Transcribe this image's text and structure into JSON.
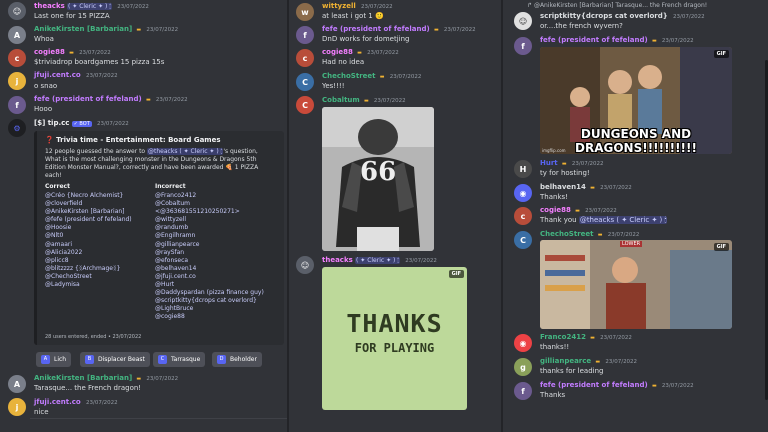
{
  "column1": {
    "messages": [
      {
        "name": "theacks",
        "decor": "( ✦ Cleric ✦ ) 🕯",
        "time": "23/07/2022",
        "text": "Last one for 15 PIZZA",
        "color": "#f47fff"
      },
      {
        "name": "AnikeKirsten [Barbarian]",
        "time": "23/07/2022",
        "text": "Whoa",
        "color": "#43b581"
      },
      {
        "name": "cogie88",
        "time": "23/07/2022",
        "text": "$triviadrop boardgames 15 pizza 15s",
        "color": "#f47fff"
      },
      {
        "name": "jfuji.cent.co",
        "time": "23/07/2022",
        "text": "o snao",
        "color": "#c27cff"
      },
      {
        "name": "fefe (president of fefeland)",
        "time": "23/07/2022",
        "text": "Hooo",
        "color": "#c27cff"
      },
      {
        "name": "[$] tip.cc",
        "bot": "✓ BOT",
        "time": "23/07/2022"
      }
    ],
    "embed": {
      "title": "Trivia time - Entertainment: Board Games",
      "desc_pre": "12 people guessed the answer to ",
      "desc_mention": "@theacks ( ✦ Cleric ✦ ) 🕯",
      "desc_post": "'s question, What is the most challenging monster in the Dungeons & Dragons 5th Edition Monster Manual?, correctly and have been awarded 🍕 1 PIZZA each!",
      "correct_label": "Correct",
      "correct": [
        "@Créo {Necro Alchemist}",
        "@cloverfield",
        "@AnikeKirsten [Barbarian]",
        "@fefe (president of fefeland)",
        "@Hoosie",
        "@Nlt0",
        "@amaari",
        "@Alicia2022",
        "@plicc8",
        "@blitzzzz {ᛝArchmageᛝ}",
        "@ChechoStreet",
        "@Ladymisa"
      ],
      "incorrect_label": "Incorrect",
      "incorrect": [
        "@Franco2412",
        "@Cobaltum",
        "<@363681551210250271>",
        "@wittyzell",
        "@randumb",
        "@Engilhramn",
        "@gillianpearce",
        "@raySfan",
        "@efonseca",
        "@belhaven14",
        "@jfuji.cent.co",
        "@Hurt",
        "@Daddyspardan (pizza finance guy)",
        "@scriptkitty{dcrops cat overlord}",
        "@LightBruce",
        "@cogie88"
      ],
      "footer": "28 users entered, ended • 23/07/2022"
    },
    "buttons": [
      {
        "letter": "A",
        "label": "Lich"
      },
      {
        "letter": "B",
        "label": "Displacer Beast"
      },
      {
        "letter": "C",
        "label": "Tarrasque"
      },
      {
        "letter": "D",
        "label": "Beholder"
      }
    ],
    "bottom_messages": [
      {
        "name": "AnikeKirsten [Barbarian]",
        "time": "23/07/2022",
        "text": "Tarasque... the French dragon!",
        "color": "#43b581"
      },
      {
        "name": "jfuji.cent.co",
        "time": "23/07/2022",
        "text": "nice",
        "color": "#c27cff"
      }
    ]
  },
  "column2": {
    "messages": [
      {
        "name": "wittyzell",
        "time": "23/07/2022",
        "text": "at least i got 1 🙂",
        "color": "#f0b232"
      },
      {
        "name": "fefe (president of fefeland)",
        "time": "23/07/2022",
        "text": "DnD works for dometjing",
        "color": "#c27cff"
      },
      {
        "name": "cogie88",
        "time": "23/07/2022",
        "text": "Had no idea",
        "color": "#f47fff"
      },
      {
        "name": "ChechoStreet",
        "time": "23/07/2022",
        "text": "Yes!!!!",
        "color": "#43b581"
      },
      {
        "name": "Cobaltum",
        "time": "23/07/2022",
        "text": "",
        "color": "#43b581"
      },
      {
        "name": "theacks",
        "decor": "( ✦ Cleric ✦ ) 🕯",
        "time": "23/07/2022",
        "text": "",
        "color": "#f47fff"
      }
    ],
    "gif_text_1": "THANKS",
    "gif_text_2": "FOR PLAYING",
    "gif_label": "GIF",
    "jersey_number": "66"
  },
  "column3": {
    "reply_text": "@AnikeKirsten [Barbarian] Tarasque... the French dragon!",
    "messages": [
      {
        "name": "scriptkitty{dcrops cat overlord}",
        "time": "23/07/2022",
        "text": "or....the french wyvern?",
        "color": "#dbdee1"
      },
      {
        "name": "fefe (president of fefeland)",
        "time": "23/07/2022",
        "text": "",
        "color": "#c27cff"
      },
      {
        "name": "Hurt",
        "time": "23/07/2022",
        "text": "ty for hosting!",
        "color": "#5865f2"
      },
      {
        "name": "belhaven14",
        "time": "23/07/2022",
        "text": "Thanks!",
        "color": "#dbdee1"
      },
      {
        "name": "cogie88",
        "time": "23/07/2022",
        "text_pre": "Thank you ",
        "mention": "@theacks ( ✦ Cleric ✦ ) 🕯",
        "color": "#f47fff"
      },
      {
        "name": "ChechoStreet",
        "time": "23/07/2022",
        "text": "",
        "color": "#43b581"
      },
      {
        "name": "Franco2412",
        "time": "23/07/2022",
        "text": "thanks!!",
        "color": "#43b581"
      },
      {
        "name": "gillianpearce",
        "time": "23/07/2022",
        "text": "thanks for leading",
        "color": "#43b581"
      },
      {
        "name": "fefe (president of fefeland)",
        "time": "23/07/2022",
        "text": "Thanks",
        "color": "#c27cff"
      }
    ],
    "gif_caption": "DUNGEONS AND DRAGONS!!!!!!!!!!",
    "gif_watermark": "imgflip.com",
    "gif_label": "GIF",
    "store_sign": "LOWER"
  }
}
